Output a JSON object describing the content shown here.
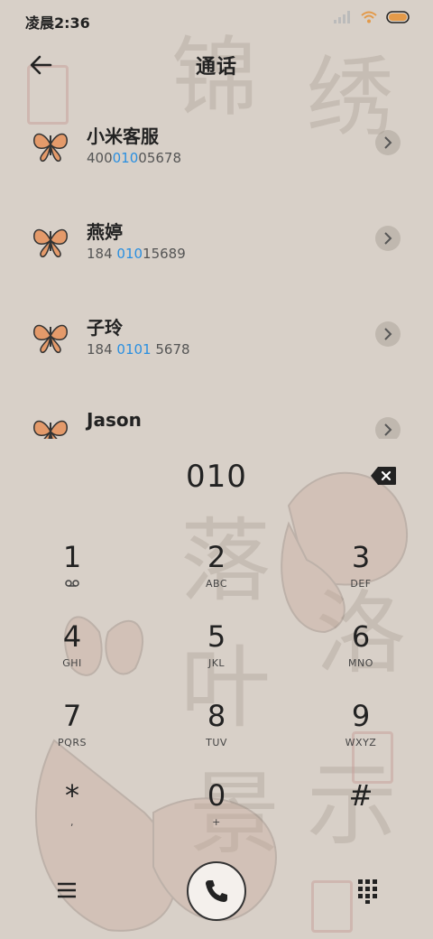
{
  "status_bar": {
    "time": "凌晨2:36",
    "icons": [
      "signal-icon",
      "wifi-icon",
      "battery-icon"
    ]
  },
  "header": {
    "title": "通话",
    "back_icon": "back-arrow-icon"
  },
  "contacts": [
    {
      "name": "小米客服",
      "number_pre": "400",
      "number_hl": "010",
      "number_post": "05678"
    },
    {
      "name": "燕婷",
      "number_pre": "184 ",
      "number_hl": "010",
      "number_post": "15689"
    },
    {
      "name": "子玲",
      "number_pre": "184 ",
      "number_hl": "0101",
      "number_post": " 5678"
    },
    {
      "name": "Jason",
      "number_pre": "",
      "number_hl": "",
      "number_post": ""
    }
  ],
  "dial": {
    "entered": "010"
  },
  "keypad": [
    {
      "digit": "1",
      "letters": ""
    },
    {
      "digit": "2",
      "letters": "ABC"
    },
    {
      "digit": "3",
      "letters": "DEF"
    },
    {
      "digit": "4",
      "letters": "GHI"
    },
    {
      "digit": "5",
      "letters": "JKL"
    },
    {
      "digit": "6",
      "letters": "MNO"
    },
    {
      "digit": "7",
      "letters": "PQRS"
    },
    {
      "digit": "8",
      "letters": "TUV"
    },
    {
      "digit": "9",
      "letters": "WXYZ"
    },
    {
      "digit": "*",
      "letters": ","
    },
    {
      "digit": "0",
      "letters": "+"
    },
    {
      "digit": "#",
      "letters": ""
    }
  ],
  "colors": {
    "background": "#d8d0c8",
    "highlight": "#2a8fe0",
    "text": "#222222"
  }
}
